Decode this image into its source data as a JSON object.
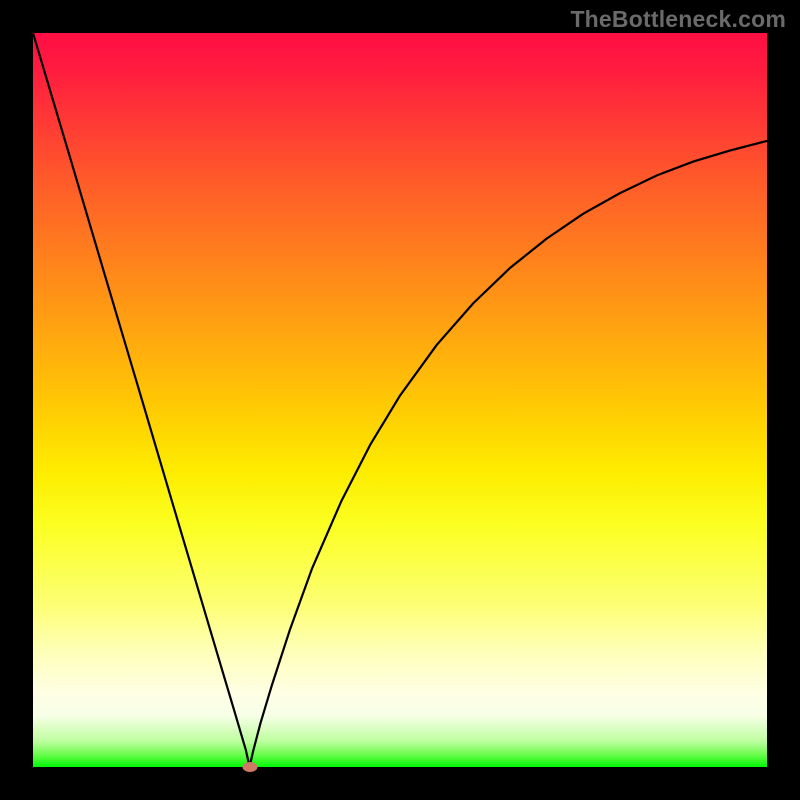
{
  "watermark": "TheBottleneck.com",
  "chart_data": {
    "type": "line",
    "title": "",
    "xlabel": "",
    "ylabel": "",
    "xlim": [
      0,
      1
    ],
    "ylim": [
      0,
      1
    ],
    "grid": false,
    "legend": false,
    "background_gradient": {
      "orientation": "vertical",
      "stops": [
        {
          "pos": 0.0,
          "color": "#ff0e43"
        },
        {
          "pos": 0.2,
          "color": "#ff5a2a"
        },
        {
          "pos": 0.4,
          "color": "#ffa210"
        },
        {
          "pos": 0.6,
          "color": "#fded00"
        },
        {
          "pos": 0.8,
          "color": "#fdff90"
        },
        {
          "pos": 0.93,
          "color": "#f7ffe6"
        },
        {
          "pos": 1.0,
          "color": "#00f806"
        }
      ]
    },
    "marker": {
      "x": 0.295,
      "y": 0.0,
      "color": "#ce7966"
    },
    "series": [
      {
        "name": "curve",
        "color": "#000000",
        "x": [
          0.0,
          0.05,
          0.1,
          0.15,
          0.2,
          0.25,
          0.275,
          0.29,
          0.295,
          0.3,
          0.31,
          0.325,
          0.35,
          0.38,
          0.42,
          0.46,
          0.5,
          0.55,
          0.6,
          0.65,
          0.7,
          0.75,
          0.8,
          0.85,
          0.9,
          0.95,
          1.0
        ],
        "y": [
          1.0,
          0.832,
          0.663,
          0.495,
          0.326,
          0.158,
          0.074,
          0.023,
          0.0,
          0.022,
          0.06,
          0.11,
          0.187,
          0.27,
          0.362,
          0.44,
          0.506,
          0.575,
          0.632,
          0.68,
          0.72,
          0.754,
          0.782,
          0.806,
          0.825,
          0.84,
          0.853
        ]
      }
    ]
  }
}
